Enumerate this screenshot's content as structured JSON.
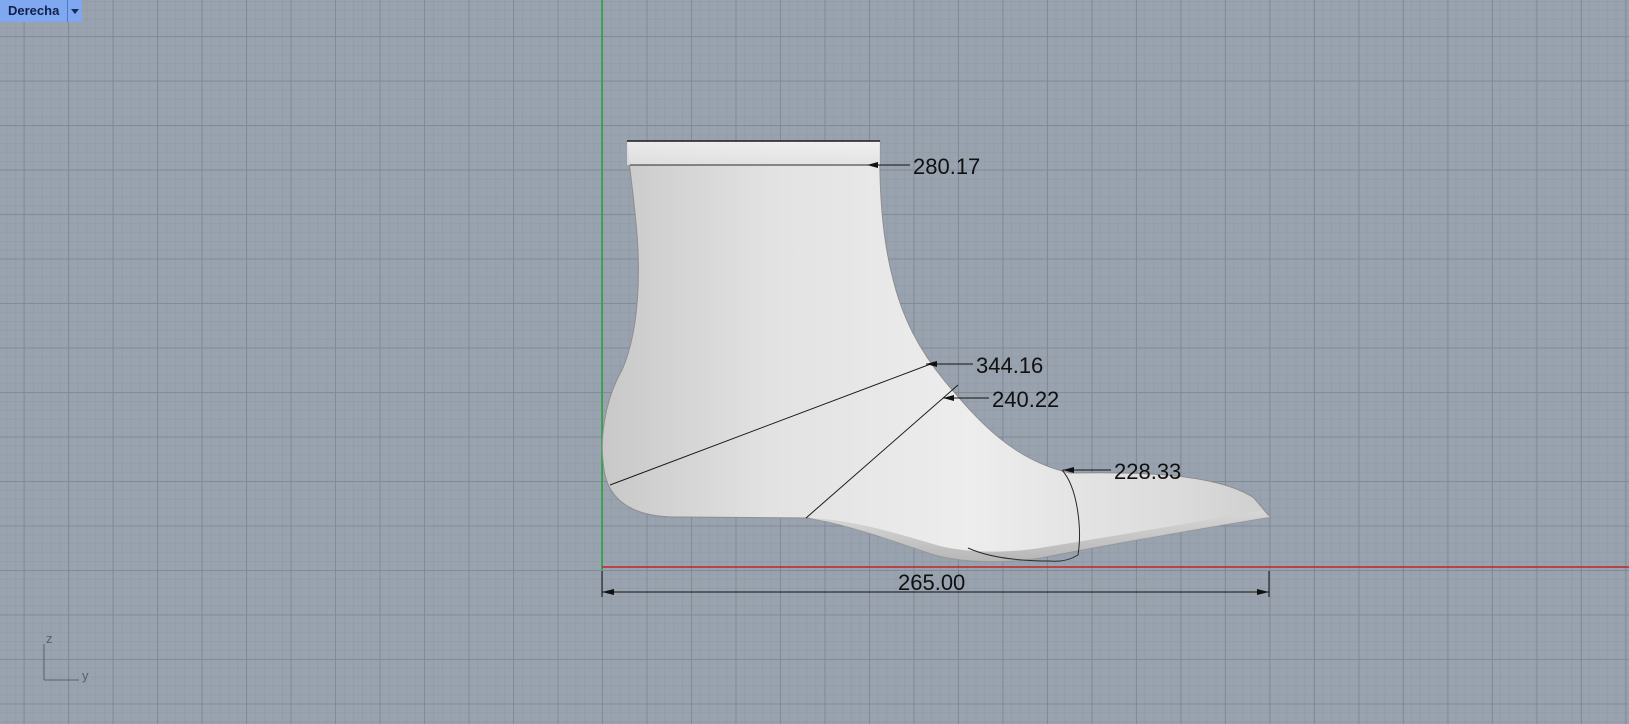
{
  "viewport": {
    "name": "Derecha"
  },
  "dimensions": {
    "top_opening": "280.17",
    "heel_diagonal": "344.16",
    "instep": "240.22",
    "ball": "228.33",
    "length": "265.00"
  },
  "axis_labels": {
    "vertical": "z",
    "horizontal": "y"
  },
  "colors": {
    "background": "#99a3af",
    "x_axis": "#c0262a",
    "y_axis": "#1fa832",
    "tab": "#7fa8f0",
    "model": "#e4e4e4"
  }
}
